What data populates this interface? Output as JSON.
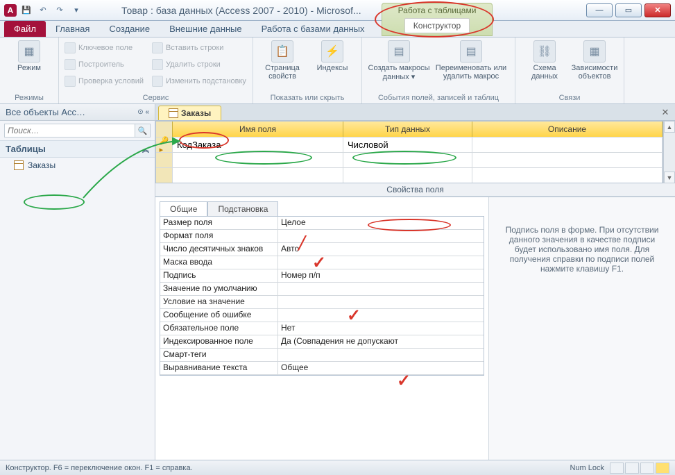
{
  "window": {
    "title": "Товар : база данных (Access 2007 - 2010) - Microsof...",
    "app_letter": "A"
  },
  "context_tab": {
    "title": "Работа с таблицами",
    "sub": "Конструктор"
  },
  "ribbon_tabs": {
    "file": "Файл",
    "home": "Главная",
    "create": "Создание",
    "external": "Внешние данные",
    "dbtools": "Работа с базами данных",
    "design": "Конструктор"
  },
  "ribbon": {
    "modes": {
      "view": "Режим",
      "group": "Режимы"
    },
    "tools": {
      "pk": "Ключевое поле",
      "builder": "Построитель",
      "validate": "Проверка условий",
      "insert_rows": "Вставить строки",
      "delete_rows": "Удалить строки",
      "modify_lookup": "Изменить подстановку",
      "group": "Сервис"
    },
    "showhide": {
      "propsheet": "Страница свойств",
      "indexes": "Индексы",
      "group": "Показать или скрыть"
    },
    "events": {
      "create_macros": "Создать макросы данных ▾",
      "rename_delete": "Переименовать или удалить макрос",
      "group": "События полей, записей и таблиц"
    },
    "relations": {
      "schema": "Схема данных",
      "deps": "Зависимости объектов",
      "group": "Связи"
    }
  },
  "nav": {
    "header": "Все объекты Acc…",
    "search_placeholder": "Поиск…",
    "group_tables": "Таблицы",
    "item_orders": "Заказы"
  },
  "doc_tab": {
    "label": "Заказы"
  },
  "grid": {
    "col_name": "Имя поля",
    "col_type": "Тип данных",
    "col_desc": "Описание",
    "row1_name": "КодЗаказа",
    "row1_type": "Числовой"
  },
  "props": {
    "title": "Свойства поля",
    "tab_general": "Общие",
    "tab_lookup": "Подстановка",
    "rows": [
      {
        "label": "Размер поля",
        "value": "Целое"
      },
      {
        "label": "Формат поля",
        "value": ""
      },
      {
        "label": "Число десятичных знаков",
        "value": "Авто"
      },
      {
        "label": "Маска ввода",
        "value": ""
      },
      {
        "label": "Подпись",
        "value": "Номер п/п"
      },
      {
        "label": "Значение по умолчанию",
        "value": ""
      },
      {
        "label": "Условие на значение",
        "value": ""
      },
      {
        "label": "Сообщение об ошибке",
        "value": ""
      },
      {
        "label": "Обязательное поле",
        "value": "Нет"
      },
      {
        "label": "Индексированное поле",
        "value": "Да (Совпадения не допускают"
      },
      {
        "label": "Смарт-теги",
        "value": ""
      },
      {
        "label": "Выравнивание текста",
        "value": "Общее"
      }
    ],
    "help": "Подпись поля в форме. При отсутствии данного значения в качестве подписи будет использовано имя поля. Для получения справки по подписи полей нажмите клавишу F1."
  },
  "status": {
    "left": "Конструктор.  F6 = переключение окон.  F1 = справка.",
    "numlock": "Num Lock"
  }
}
